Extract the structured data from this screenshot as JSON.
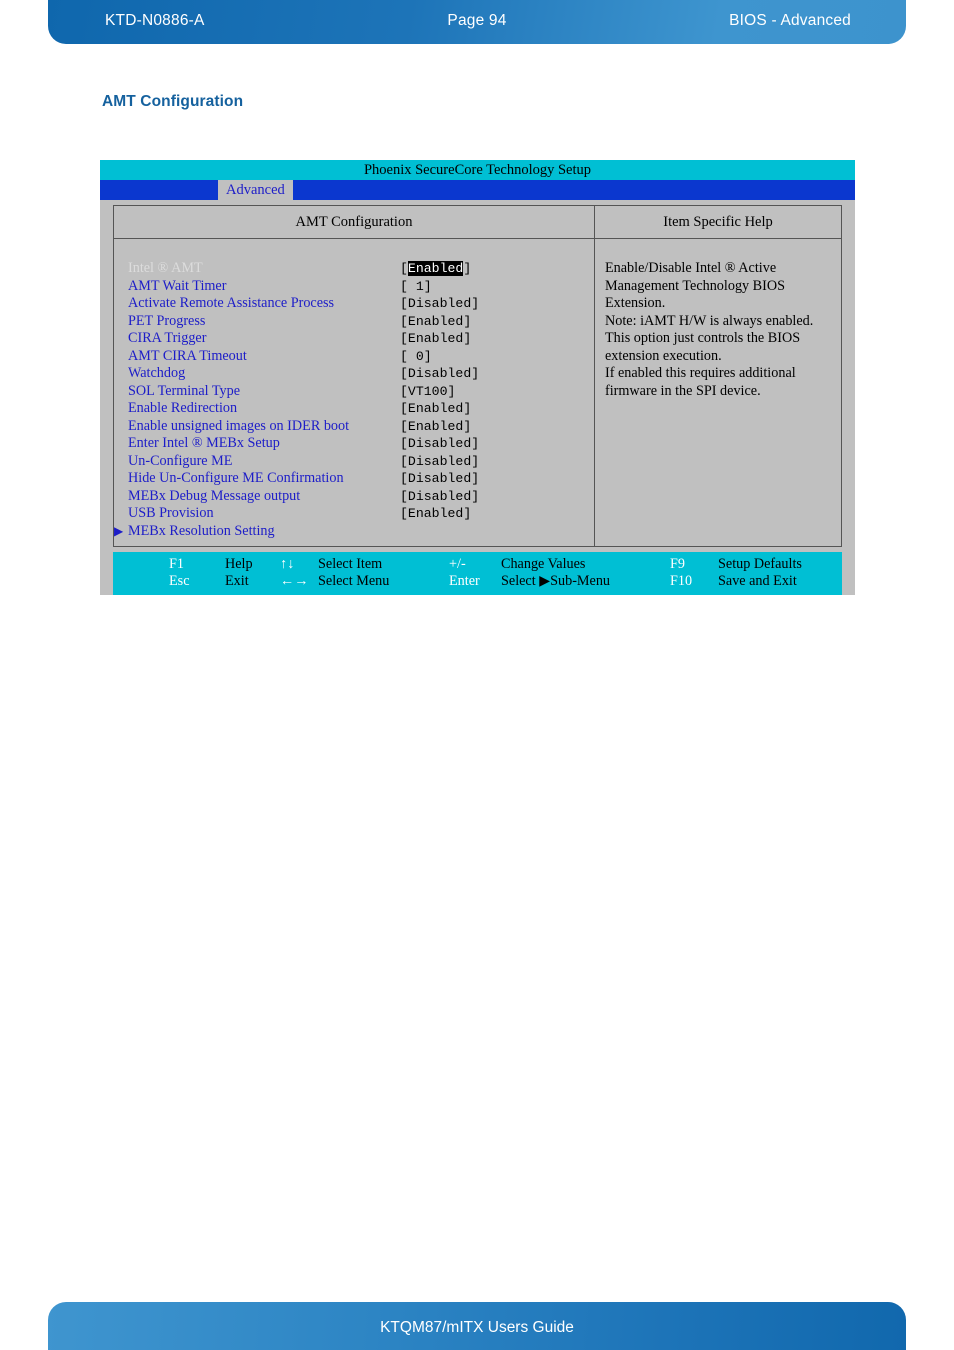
{
  "header": {
    "left": "KTD-N0886-A",
    "middle": "Page 94",
    "right": "BIOS  - Advanced"
  },
  "footer": {
    "text": "KTQM87/mITX Users Guide"
  },
  "section": {
    "title": "AMT Configuration"
  },
  "bios": {
    "title": "Phoenix SecureCore Technology Setup",
    "menu_tab": "Advanced",
    "left_panel_header": "AMT Configuration",
    "right_panel_header": "Item Specific Help",
    "options": [
      {
        "arrow": "",
        "label": "Intel ® AMT",
        "value_prefix": "[",
        "value": "Enabled",
        "value_suffix": "]",
        "selected": true
      },
      {
        "arrow": "",
        "label": "AMT Wait Timer",
        "value_prefix": "[",
        "value": "    1",
        "value_suffix": "]",
        "selected": false
      },
      {
        "arrow": "",
        "label": "Activate Remote Assistance Process",
        "value_prefix": "[",
        "value": "Disabled",
        "value_suffix": "]",
        "selected": false
      },
      {
        "arrow": "",
        "label": "PET Progress",
        "value_prefix": "[",
        "value": "Enabled",
        "value_suffix": "]",
        "selected": false
      },
      {
        "arrow": "",
        "label": "CIRA Trigger",
        "value_prefix": "[",
        "value": "Enabled",
        "value_suffix": "]",
        "selected": false
      },
      {
        "arrow": "",
        "label": "AMT CIRA Timeout",
        "value_prefix": "[",
        "value": "    0",
        "value_suffix": "]",
        "selected": false
      },
      {
        "arrow": "",
        "label": "Watchdog",
        "value_prefix": "[",
        "value": "Disabled",
        "value_suffix": "]",
        "selected": false
      },
      {
        "arrow": "",
        "label": "SOL Terminal Type",
        "value_prefix": "[",
        "value": "VT100",
        "value_suffix": "]",
        "selected": false
      },
      {
        "arrow": "",
        "label": "Enable Redirection",
        "value_prefix": "[",
        "value": "Enabled",
        "value_suffix": "]",
        "selected": false
      },
      {
        "arrow": "",
        "label": "Enable unsigned images on IDER boot",
        "value_prefix": "[",
        "value": "Enabled",
        "value_suffix": "]",
        "selected": false
      },
      {
        "arrow": "",
        "label": "Enter Intel ® MEBx Setup",
        "value_prefix": "[",
        "value": "Disabled",
        "value_suffix": "]",
        "selected": false
      },
      {
        "arrow": "",
        "label": "Un-Configure ME",
        "value_prefix": "[",
        "value": "Disabled",
        "value_suffix": "]",
        "selected": false
      },
      {
        "arrow": "",
        "label": "Hide Un-Configure ME Confirmation",
        "value_prefix": "[",
        "value": "Disabled",
        "value_suffix": "]",
        "selected": false
      },
      {
        "arrow": "",
        "label": "MEBx Debug Message output",
        "value_prefix": "[",
        "value": "Disabled",
        "value_suffix": "]",
        "selected": false
      },
      {
        "arrow": "",
        "label": "USB Provision",
        "value_prefix": "[",
        "value": "Enabled",
        "value_suffix": "]",
        "selected": false
      },
      {
        "arrow": "▶",
        "label": "MEBx Resolution Setting",
        "value_prefix": "",
        "value": "",
        "value_suffix": "",
        "selected": false
      }
    ],
    "help_lines": [
      "Enable/Disable Intel ® Active",
      "Management Technology BIOS",
      "Extension.",
      "Note: iAMT H/W is always enabled.",
      "This option just controls the BIOS",
      "extension execution.",
      "If enabled this requires additional",
      "firmware in the SPI device."
    ],
    "keybar": {
      "row1": [
        {
          "key": "F1",
          "desc": "Help"
        },
        {
          "key": "↑↓",
          "desc": "Select Item"
        },
        {
          "key": "+/-",
          "desc": "Change Values"
        },
        {
          "key": "F9",
          "desc": "Setup Defaults"
        }
      ],
      "row2": [
        {
          "key": "Esc",
          "desc": "Exit"
        },
        {
          "key": "←→",
          "desc": "Select Menu"
        },
        {
          "key": "Enter",
          "desc": "Select ▶Sub-Menu"
        },
        {
          "key": "F10",
          "desc": "Save and Exit"
        }
      ]
    }
  },
  "colors": {
    "brand_blue": "#15619e",
    "bios_title_cyan": "#00bfd4",
    "bios_menu_blue": "#0b37cf",
    "bios_gray": "#c0c0c0",
    "bios_text_blue": "#1d1dc8"
  }
}
